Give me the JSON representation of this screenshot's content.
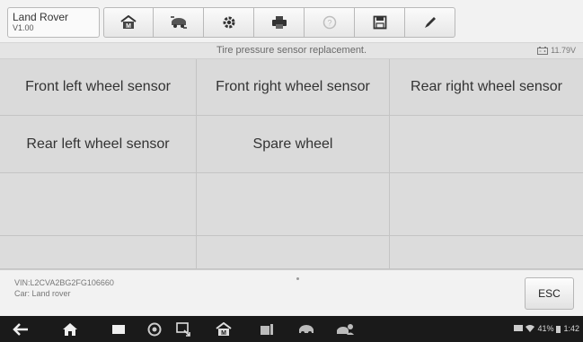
{
  "app": {
    "brand": "Land Rover",
    "version": "V1.00"
  },
  "toolbar": {
    "buttons": [
      {
        "name": "home-button",
        "icon": "home-m-icon"
      },
      {
        "name": "vehicle-swap-button",
        "icon": "car-swap-icon"
      },
      {
        "name": "settings-button",
        "icon": "gear-icon"
      },
      {
        "name": "print-button",
        "icon": "printer-icon"
      },
      {
        "name": "help-button",
        "icon": "help-icon"
      },
      {
        "name": "save-button",
        "icon": "floppy-icon"
      },
      {
        "name": "edit-button",
        "icon": "pencil-icon"
      }
    ]
  },
  "subheader": {
    "title": "Tire pressure sensor replacement.",
    "voltage": "11.79V"
  },
  "grid": {
    "rows": [
      [
        "Front left wheel sensor",
        "Front right wheel sensor",
        "Rear right wheel sensor"
      ],
      [
        "Rear left wheel sensor",
        "Spare wheel",
        ""
      ],
      [
        "",
        "",
        ""
      ],
      [
        "",
        "",
        ""
      ]
    ]
  },
  "footer": {
    "vin": "VIN:L2CVA2BG2FG106660",
    "car": "Car: Land rover",
    "esc_label": "ESC"
  },
  "statusbar": {
    "battery": "41%",
    "time": "1:42"
  },
  "colors": {
    "header_bg": "#f2f2f2",
    "grid_bg": "#dadada",
    "navbar_bg": "#1a1a1a"
  }
}
